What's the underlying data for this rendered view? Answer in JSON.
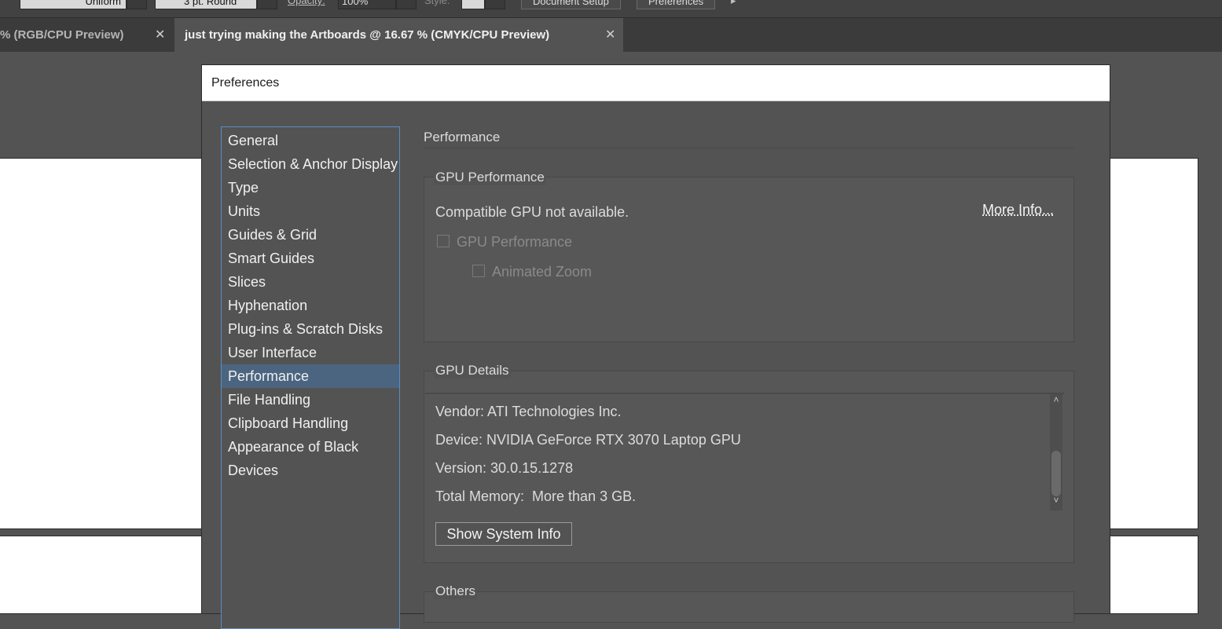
{
  "control_bar": {
    "stroke_profile": "Uniform",
    "brush": "3 pt. Round",
    "opacity_label": "Opacity:",
    "opacity_value": "100%",
    "style_label": "Style:",
    "document_setup": "Document Setup",
    "preferences": "Preferences"
  },
  "tabs": [
    {
      "label": "% (RGB/CPU Preview)",
      "close": "✕"
    },
    {
      "label": "just trying making the Artboards @ 16.67 % (CMYK/CPU Preview)",
      "close": "✕"
    }
  ],
  "dialog": {
    "title": "Preferences",
    "nav": [
      {
        "label": "General"
      },
      {
        "label": "Selection & Anchor Display"
      },
      {
        "label": "Type"
      },
      {
        "label": "Units"
      },
      {
        "label": "Guides & Grid"
      },
      {
        "label": "Smart Guides"
      },
      {
        "label": "Slices"
      },
      {
        "label": "Hyphenation"
      },
      {
        "label": "Plug-ins & Scratch Disks"
      },
      {
        "label": "User Interface"
      },
      {
        "label": "Performance"
      },
      {
        "label": "File Handling"
      },
      {
        "label": "Clipboard Handling"
      },
      {
        "label": "Appearance of Black"
      },
      {
        "label": "Devices"
      }
    ],
    "selected_nav": "Performance",
    "panel_title": "Performance",
    "gpu_performance": {
      "group_label": "GPU Performance",
      "status": "Compatible GPU not available.",
      "more_info": "More Info...",
      "gpu_checkbox_label": "GPU Performance",
      "gpu_checked": false,
      "zoom_checkbox_label": "Animated Zoom",
      "zoom_checked": false
    },
    "gpu_details": {
      "group_label": "GPU Details",
      "vendor": "Vendor: ATI Technologies Inc.",
      "device": "Device: NVIDIA GeForce RTX 3070 Laptop GPU",
      "version": "Version: 30.0.15.1278",
      "memory": "Total Memory:  More than 3 GB.",
      "show_system_info": "Show System Info"
    },
    "others": {
      "group_label": "Others"
    }
  },
  "colors": {
    "selection": "#4b6580",
    "focus_border": "#5a8ec7"
  }
}
